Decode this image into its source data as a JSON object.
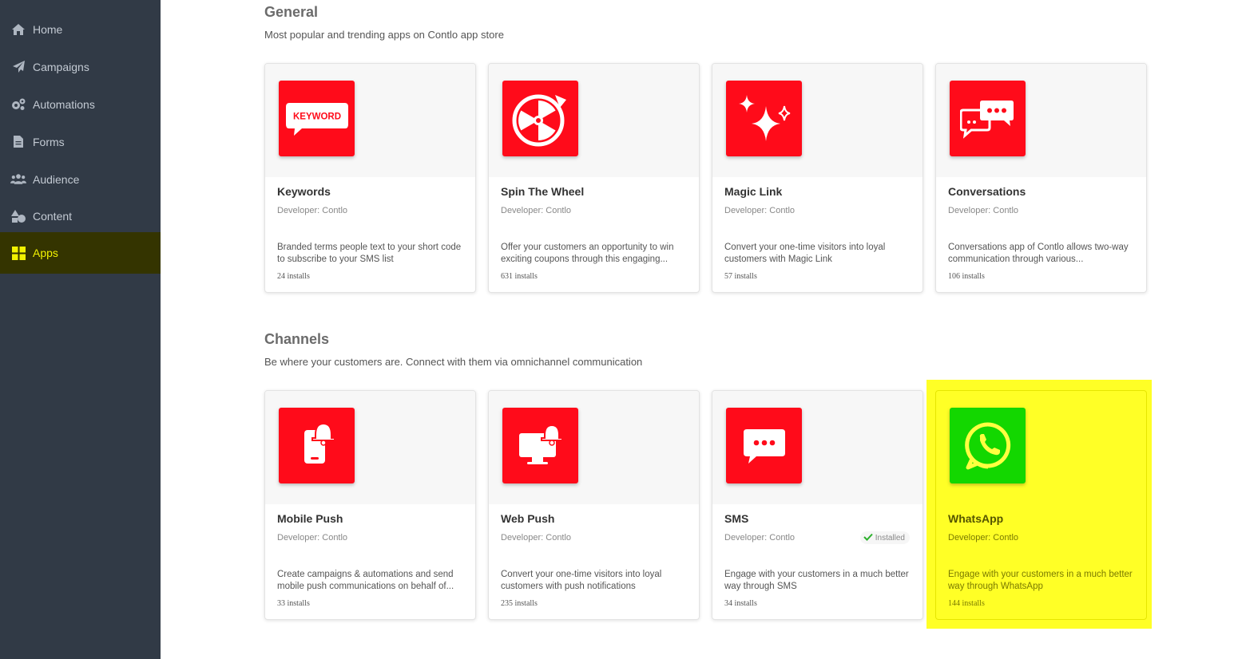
{
  "sidebar": {
    "items": [
      {
        "label": "Home",
        "icon": "home-icon"
      },
      {
        "label": "Campaigns",
        "icon": "paper-plane-icon"
      },
      {
        "label": "Automations",
        "icon": "gears-icon"
      },
      {
        "label": "Forms",
        "icon": "document-icon"
      },
      {
        "label": "Audience",
        "icon": "users-icon"
      },
      {
        "label": "Content",
        "icon": "shapes-icon"
      },
      {
        "label": "Apps",
        "icon": "grid-icon",
        "active": true
      }
    ]
  },
  "sections": [
    {
      "title": "General",
      "subtitle": "Most popular and trending apps on Contlo app store",
      "cards": [
        {
          "name": "Keywords",
          "developer": "Developer: Contlo",
          "description": "Branded terms people text to your short code to subscribe to your SMS list",
          "installs": "24 installs",
          "icon": "keyword-icon",
          "tile_text": "KEYWORD"
        },
        {
          "name": "Spin The Wheel",
          "developer": "Developer: Contlo",
          "description": "Offer your customers an opportunity to win exciting coupons through this engaging...",
          "installs": "631 installs",
          "icon": "wheel-icon"
        },
        {
          "name": "Magic Link",
          "developer": "Developer: Contlo",
          "description": "Convert your one-time visitors into loyal customers with Magic Link",
          "installs": "57 installs",
          "icon": "sparkles-icon"
        },
        {
          "name": "Conversations",
          "developer": "Developer: Contlo",
          "description": "Conversations app of Contlo allows two-way communication through various...",
          "installs": "106 installs",
          "icon": "chat-bubbles-icon"
        }
      ]
    },
    {
      "title": "Channels",
      "subtitle": "Be where your customers are. Connect with them via omnichannel communication",
      "cards": [
        {
          "name": "Mobile Push",
          "developer": "Developer: Contlo",
          "description": "Create campaigns & automations and send mobile push communications on behalf of...",
          "installs": "33 installs",
          "icon": "mobile-bell-icon"
        },
        {
          "name": "Web Push",
          "developer": "Developer: Contlo",
          "description": "Convert your one-time visitors into loyal customers with push notifications",
          "installs": "235 installs",
          "icon": "monitor-bell-icon"
        },
        {
          "name": "SMS",
          "developer": "Developer: Contlo",
          "description": "Engage with your customers in a much better way through SMS",
          "installs": "34 installs",
          "icon": "sms-bubble-icon",
          "badge": "Installed"
        },
        {
          "name": "WhatsApp",
          "developer": "Developer: Contlo",
          "description": "Engage with your customers in a much better way through WhatsApp",
          "installs": "144 installs",
          "icon": "whatsapp-icon"
        }
      ]
    }
  ],
  "colors": {
    "sidebar_bg": "#313a46",
    "active_bg": "#343400",
    "active_fg": "#f2f200",
    "tile_red": "#ff0b1a",
    "tile_green": "#13d700",
    "highlight": "#ffff00"
  }
}
